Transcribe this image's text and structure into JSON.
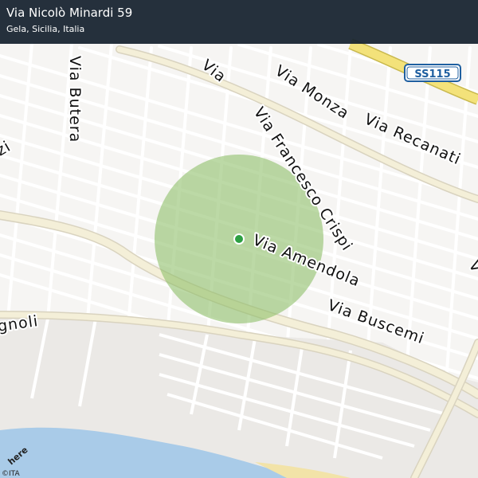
{
  "header": {
    "title": "Via Nicolò Minardi 59",
    "subtitle": "Gela, Sicilia, Italia"
  },
  "map": {
    "streets": {
      "via_buttera": "Via Butera",
      "via_left_top": "zi",
      "via_monza": "Via Monza",
      "via_recanati": "Via Recanati",
      "via_francesco_crispi": "Via Francesco Crispi",
      "via_amendola": "Via Amendola",
      "via_buscemi": "Via Buscemi",
      "via_gnoli": "gnoli",
      "via_upper": "Via",
      "right_edge_v": "V"
    },
    "road_shield": "SS115",
    "logo": "here",
    "copyright": "©ITA",
    "colors": {
      "background": "#e9e7e4",
      "block": "#f6f5f3",
      "road": "#ffffff",
      "major_road": "#f4efd8",
      "highway": "#f3e27a",
      "sea": "#a9cbe8",
      "beach": "#f2e3a8",
      "radius_fill": "#8fc06a",
      "marker": "#2ea043"
    }
  }
}
